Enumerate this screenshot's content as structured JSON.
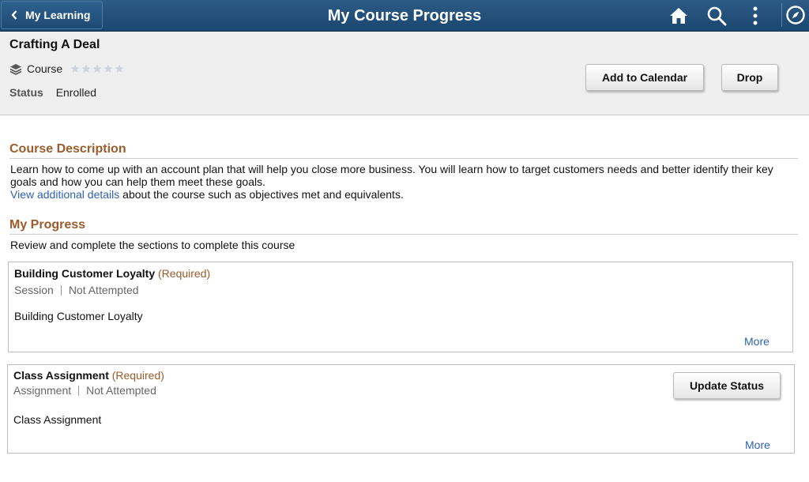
{
  "header": {
    "back_label": "My Learning",
    "title": "My Course Progress",
    "icons": [
      "home-icon",
      "search-icon",
      "more-vertical-icon",
      "navigation-compass-icon"
    ]
  },
  "course": {
    "title": "Crafting A Deal",
    "type": "Course",
    "rating": 0,
    "rating_max": 5,
    "status_label": "Status",
    "status_value": "Enrolled"
  },
  "actions": {
    "add_to_calendar": "Add to Calendar",
    "drop": "Drop"
  },
  "description": {
    "heading": "Course Description",
    "text": "Learn how to come up with an account plan that will help you close more business. You will learn how to target customers needs and better identify their key goals and how you can help them meet these goals.",
    "link_text": "View additional details",
    "link_suffix": " about the course such as objectives met and equivalents."
  },
  "progress": {
    "heading": "My Progress",
    "intro": "Review and complete the sections to complete this course",
    "sections": [
      {
        "title": "Building Customer Loyalty",
        "required": "(Required)",
        "kind": "Session",
        "status": "Not Attempted",
        "body": "Building Customer Loyalty",
        "more": "More"
      },
      {
        "title": "Class Assignment",
        "required": "(Required)",
        "kind": "Assignment",
        "status": "Not Attempted",
        "body": "Class Assignment",
        "more": "More",
        "action": "Update Status"
      }
    ]
  },
  "colors": {
    "header_bg": "#1f4c75",
    "accent_heading": "#9c5b2a",
    "link": "#2f62b3",
    "summary_bg": "#efefef"
  }
}
